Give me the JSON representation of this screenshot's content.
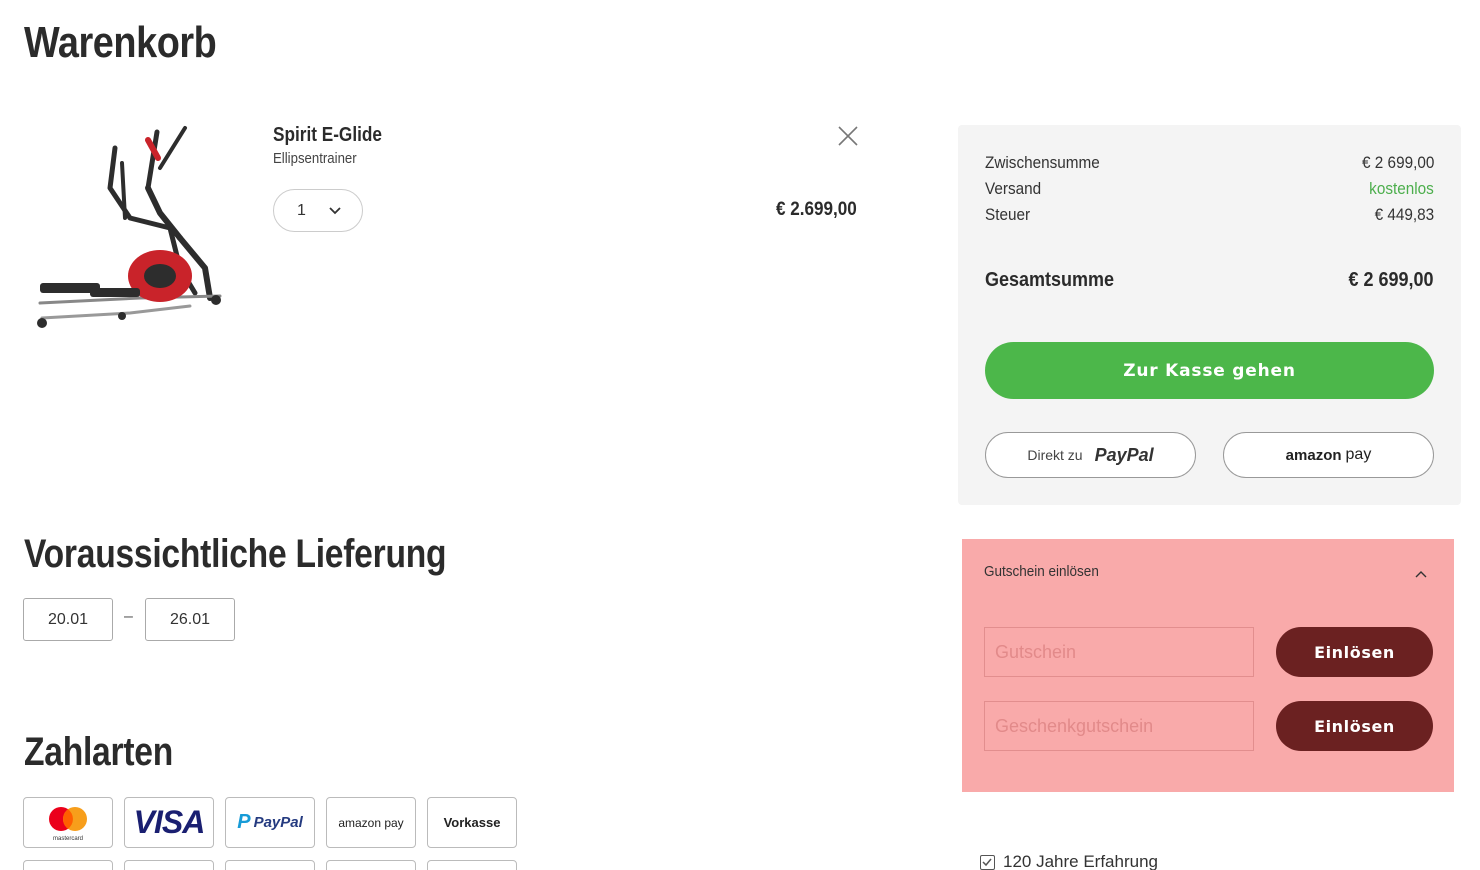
{
  "page": {
    "title": "Warenkorb"
  },
  "cart": {
    "item": {
      "name": "Spirit E-Glide",
      "category": "Ellipsentrainer",
      "quantity": "1",
      "price": "€ 2.699,00"
    }
  },
  "delivery": {
    "title": "Voraussichtliche Lieferung",
    "from": "20.01",
    "dash": "–",
    "to": "26.01"
  },
  "payment": {
    "title": "Zahlarten",
    "methods": [
      "mastercard",
      "VISA",
      "PayPal",
      "amazon pay",
      "Vorkasse"
    ]
  },
  "summary": {
    "subtotal_label": "Zwischensumme",
    "subtotal_value": "€ 2 699,00",
    "shipping_label": "Versand",
    "shipping_value": "kostenlos",
    "tax_label": "Steuer",
    "tax_value": "€ 449,83",
    "total_label": "Gesamtsumme",
    "total_value": "€ 2 699,00",
    "checkout_label": "Zur Kasse gehen",
    "paypal_prefix": "Direkt zu",
    "paypal_label": "PayPal",
    "amazon_label": "amazon",
    "amazon_suffix": "pay"
  },
  "voucher": {
    "header": "Gutschein einlösen",
    "coupon_placeholder": "Gutschein",
    "gift_placeholder": "Geschenkgutschein",
    "redeem_label": "Einlösen"
  },
  "trust": {
    "experience": "120 Jahre Erfahrung"
  },
  "colors": {
    "checkout": "#4cb74a",
    "free_shipping": "#4cae4c",
    "redeem": "#6b2121",
    "voucher_bg": "#f9aaaa"
  }
}
